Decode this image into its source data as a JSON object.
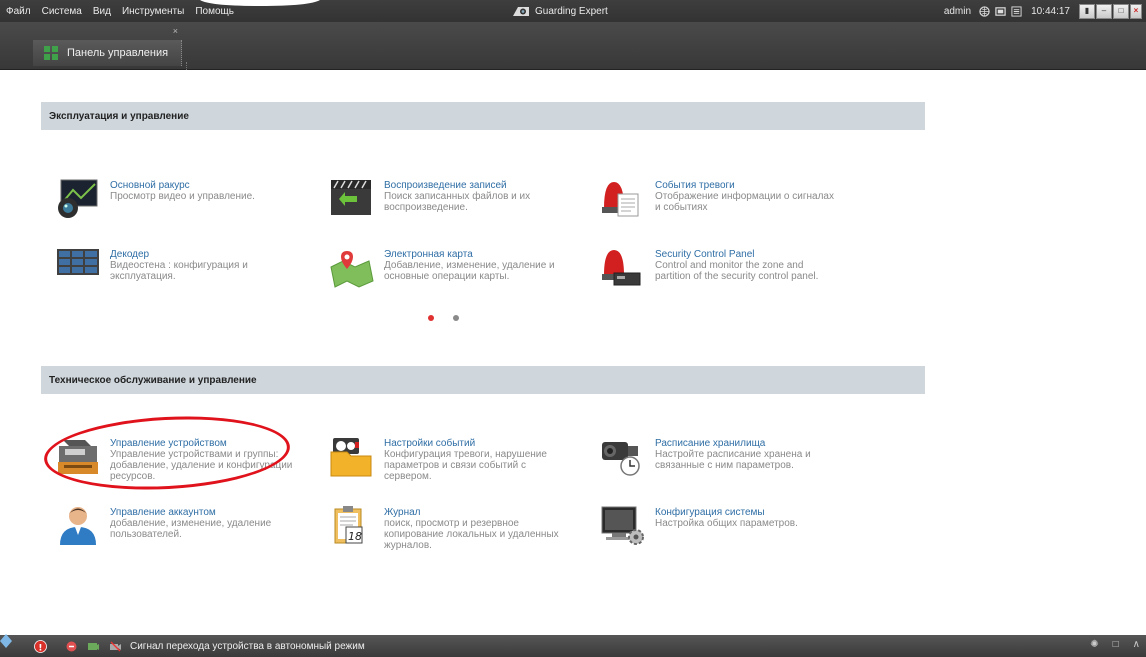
{
  "menu": [
    "Файл",
    "Система",
    "Вид",
    "Инструменты",
    "Помощь"
  ],
  "app_title": "Guarding Expert",
  "topbar": {
    "user": "admin",
    "clock": "10:44:17",
    "icons": [
      "globe-icon",
      "screen-icon",
      "ram-icon",
      "lock-icon"
    ],
    "window_buttons": [
      "minimize",
      "maximize",
      "close"
    ]
  },
  "tab": {
    "label": "Панель управления",
    "close": "×",
    "icon": "control-panel-icon"
  },
  "sections": [
    {
      "title": "Эксплуатация и управление",
      "modules": [
        {
          "title": "Основной ракурс",
          "desc": "Просмотр видео и управление.",
          "icon": "camera-view-icon"
        },
        {
          "title": "Воспроизведение записей",
          "desc": "Поиск записанных файлов и их воспроизведение.",
          "icon": "playback-icon"
        },
        {
          "title": "События тревоги",
          "desc": "Отображение информации о сигналах и событиях",
          "icon": "alarm-event-icon"
        },
        {
          "title": "Декодер",
          "desc": "Видеостена : конфигурация и эксплуатация.",
          "icon": "decoder-icon"
        },
        {
          "title": "Электронная карта",
          "desc": "Добавление, изменение, удаление и основные операции карты.",
          "icon": "emap-icon"
        },
        {
          "title": "Security Control Panel",
          "desc": "Control and monitor the zone and partition of the security control panel.",
          "icon": "security-panel-icon"
        }
      ]
    },
    {
      "title": "Техническое обслуживание и управление",
      "modules": [
        {
          "title": "Управление устройством",
          "desc": "Управление устройствами и группы: добавление, удаление и конфигурации ресурсов.",
          "icon": "device-management-icon"
        },
        {
          "title": "Настройки событий",
          "desc": "Конфигурация тревоги, нарушение параметров и связи событий с сервером.",
          "icon": "event-settings-icon"
        },
        {
          "title": "Расписание хранилища",
          "desc": "Настройте расписание хранена и связанные с ним параметров.",
          "icon": "storage-schedule-icon"
        },
        {
          "title": "Управление аккаунтом",
          "desc": "добавление, изменение, удаление пользователей.",
          "icon": "account-icon"
        },
        {
          "title": "Журнал",
          "desc": "поиск, просмотр и резервное копирование локальных и удаленных журналов.",
          "icon": "log-icon"
        },
        {
          "title": "Конфигурация системы",
          "desc": "Настройка общих параметров.",
          "icon": "system-config-icon"
        }
      ]
    }
  ],
  "pagination": {
    "pages": 2,
    "current": 1
  },
  "colors": {
    "accent": "#2f6ea5",
    "header_bg": "#cfd7dd",
    "highlight_ring": "#e0121b",
    "active_dot": "#e03030"
  },
  "statusbar": {
    "text": "Сигнал перехода устройства в автономный режим"
  }
}
